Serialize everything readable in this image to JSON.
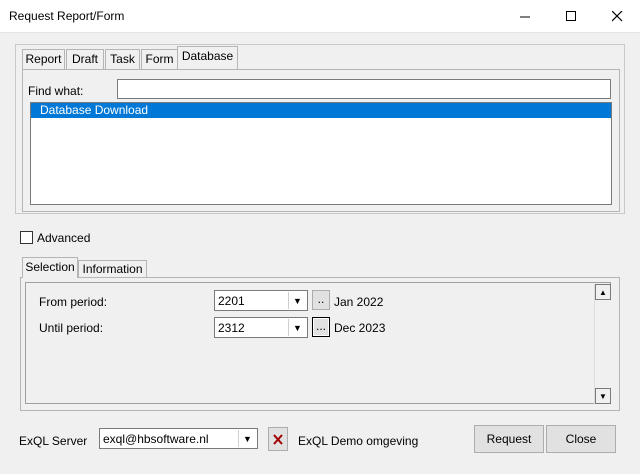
{
  "window": {
    "title": "Request Report/Form",
    "minimize_icon": "minimize-icon",
    "maximize_icon": "maximize-icon",
    "close_icon": "close-icon"
  },
  "top_tabs": [
    {
      "label": "Report"
    },
    {
      "label": "Draft"
    },
    {
      "label": "Task"
    },
    {
      "label": "Form"
    },
    {
      "label": "Database",
      "active": true
    }
  ],
  "find": {
    "label": "Find what:",
    "value": ""
  },
  "list": {
    "items": [
      {
        "label": "Database Download",
        "selected": true
      }
    ]
  },
  "advanced": {
    "label": "Advanced",
    "checked": false
  },
  "lower_tabs": [
    {
      "label": "Selection",
      "active": true
    },
    {
      "label": "Information"
    }
  ],
  "selection": {
    "from": {
      "label": "From period:",
      "value": "2201",
      "button": "..",
      "display": "Jan 2022"
    },
    "until": {
      "label": "Until period:",
      "value": "2312",
      "button": "...",
      "display": "Dec 2023"
    }
  },
  "footer": {
    "server_label": "ExQL Server",
    "server_value": "exql@hbsoftware.nl",
    "server_name": "ExQL Demo omgeving",
    "disconnect_icon": "red-x-icon",
    "request_label": "Request",
    "close_label": "Close"
  },
  "colors": {
    "selection": "#0078d7",
    "disconnect": "#a00000"
  }
}
